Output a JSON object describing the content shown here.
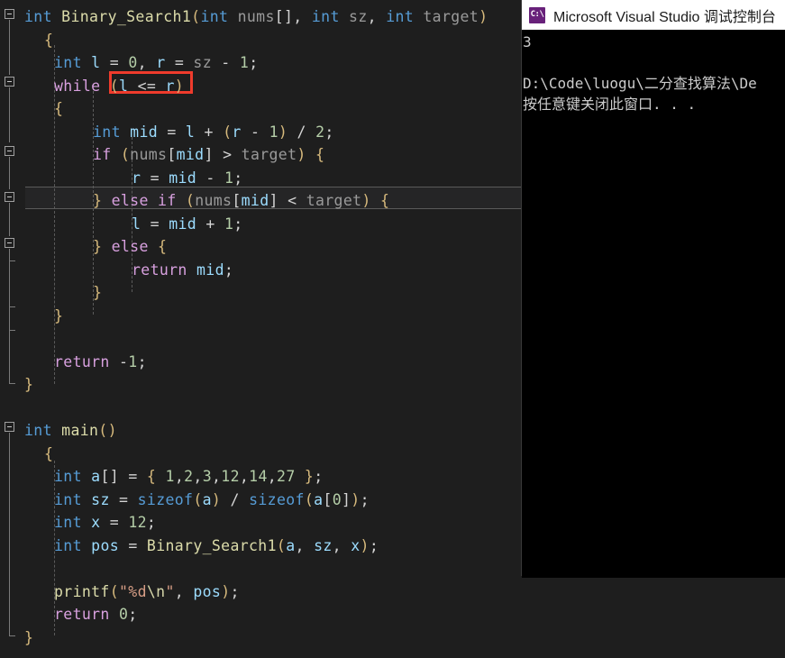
{
  "editor": {
    "background": "#1e1e1e",
    "font_size_px": 16.5,
    "line_height_px": 25.5,
    "current_statement_line_index": 8,
    "annotation": {
      "type": "red-rectangle",
      "color": "#ef3b2c",
      "target_text": "(l <= r)"
    },
    "lines": [
      {
        "indent": 0,
        "text": "int Binary_Search1(int nums[], int sz, int target)"
      },
      {
        "indent": 0,
        "text": "{"
      },
      {
        "indent": 1,
        "text": "int l = 0, r = sz - 1;"
      },
      {
        "indent": 1,
        "text": "while (l <= r)"
      },
      {
        "indent": 1,
        "text": "{"
      },
      {
        "indent": 2,
        "text": "int mid = l + (r - 1) / 2;"
      },
      {
        "indent": 2,
        "text": "if (nums[mid] > target) {"
      },
      {
        "indent": 3,
        "text": "r = mid - 1;"
      },
      {
        "indent": 2,
        "text": "} else if (nums[mid] < target) {"
      },
      {
        "indent": 3,
        "text": "l = mid + 1;"
      },
      {
        "indent": 2,
        "text": "} else {"
      },
      {
        "indent": 3,
        "text": "return mid;"
      },
      {
        "indent": 2,
        "text": "}"
      },
      {
        "indent": 1,
        "text": "}"
      },
      {
        "indent": 0,
        "text": ""
      },
      {
        "indent": 1,
        "text": "return -1;"
      },
      {
        "indent": 0,
        "text": "}"
      },
      {
        "indent": 0,
        "text": ""
      },
      {
        "indent": 0,
        "text": ""
      },
      {
        "indent": 0,
        "text": "int main()"
      },
      {
        "indent": 0,
        "text": "{"
      },
      {
        "indent": 1,
        "text": "int a[] = { 1,2,3,12,14,27 };"
      },
      {
        "indent": 1,
        "text": "int sz = sizeof(a) / sizeof(a[0]);"
      },
      {
        "indent": 1,
        "text": "int x = 12;"
      },
      {
        "indent": 1,
        "text": "int pos = Binary_Search1(a, sz, x);"
      },
      {
        "indent": 0,
        "text": ""
      },
      {
        "indent": 1,
        "text": "printf(\"%d\\n\", pos);"
      },
      {
        "indent": 1,
        "text": "return 0;"
      },
      {
        "indent": 0,
        "text": "}"
      }
    ]
  },
  "console": {
    "title": "Microsoft Visual Studio 调试控制台",
    "icon": "console-app-icon",
    "icon_glyph": "C:\\",
    "icon_color": "#68217a",
    "output_lines": [
      "3",
      "",
      "D:\\Code\\luogu\\二分查找算法\\De",
      "按任意键关闭此窗口. . ."
    ]
  },
  "colors": {
    "editor_background": "#1e1e1e",
    "console_background": "#000000",
    "console_titlebar": "#ffffff",
    "keyword_type": "#569cd6",
    "control_keyword": "#d8a0df",
    "function_name": "#dcdcaa",
    "variable": "#9cdcfe",
    "identifier": "#9a9a9a",
    "number": "#b5cea8",
    "brace": "#d7ba7d",
    "string": "#d69d85",
    "annotation_red": "#ef3b2c",
    "current_line_border": "#5a5a5a"
  }
}
